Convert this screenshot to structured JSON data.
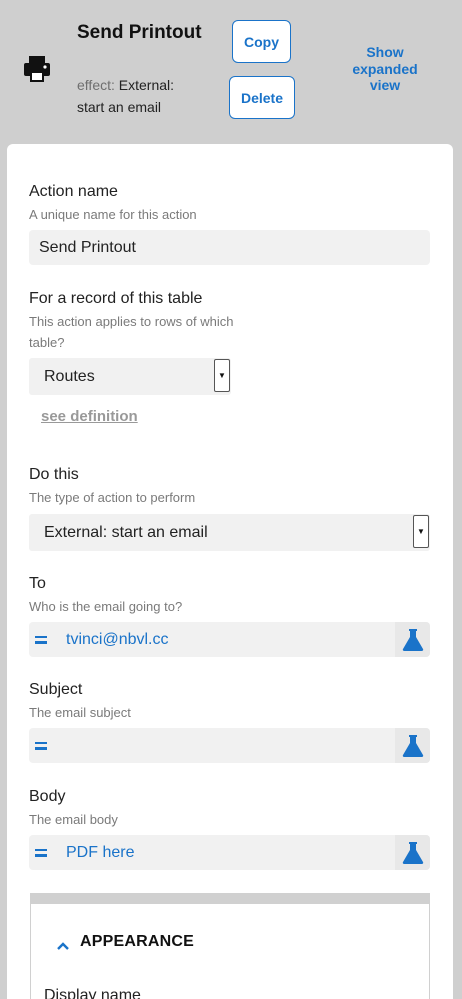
{
  "header": {
    "title": "Send Printout",
    "effect_label": "effect:",
    "effect_value": "External: start an email",
    "copy_label": "Copy",
    "delete_label": "Delete",
    "expand_label": "Show expanded view",
    "icon": "printer-icon"
  },
  "form": {
    "action_name": {
      "label": "Action name",
      "help": "A unique name for this action",
      "value": "Send Printout"
    },
    "table": {
      "label": "For a record of this table",
      "help": "This action applies to rows of which table?",
      "value": "Routes",
      "see_definition": "see definition"
    },
    "do_this": {
      "label": "Do this",
      "help": "The type of action to perform",
      "value": "External: start an email"
    },
    "to": {
      "label": "To",
      "help": "Who is the email going to?",
      "value": "tvinci@nbvl.cc"
    },
    "subject": {
      "label": "Subject",
      "help": "The email subject",
      "value": ""
    },
    "body": {
      "label": "Body",
      "help": "The email body",
      "value": "PDF here"
    }
  },
  "appearance": {
    "title": "APPEARANCE",
    "display_name_label": "Display name"
  },
  "colors": {
    "accent": "#1a73c9",
    "header_bg": "#cfcfcf",
    "field_bg": "#f1f1f1"
  }
}
